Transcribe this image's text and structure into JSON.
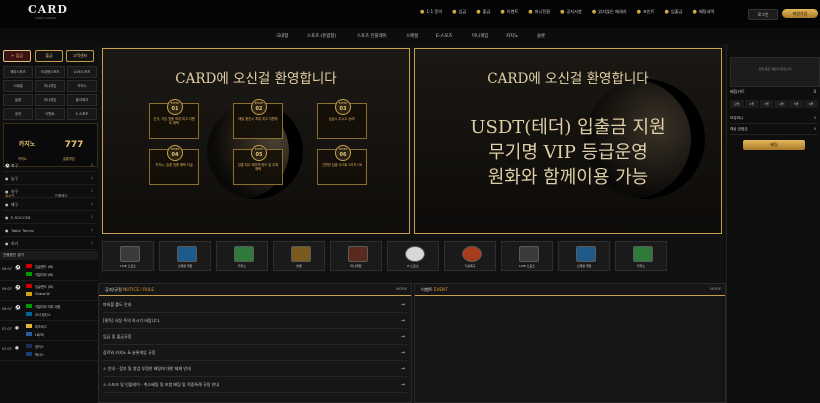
{
  "brand": {
    "logo": "CARD",
    "logo_sub": "CARD CASINO"
  },
  "topnav": [
    {
      "icon": "●",
      "label": "1:1 문의"
    },
    {
      "icon": "●",
      "label": "입금"
    },
    {
      "icon": "●",
      "label": "출금"
    },
    {
      "icon": "●",
      "label": "이벤트"
    },
    {
      "icon": "●",
      "label": "머니전환"
    },
    {
      "icon": "●",
      "label": "공지사항"
    },
    {
      "icon": "●",
      "label": "읽지않은 메세지"
    },
    {
      "icon": "●",
      "label": "포인트"
    },
    {
      "icon": "●",
      "label": "입출금"
    },
    {
      "icon": "●",
      "label": "배팅내역"
    }
  ],
  "points_label": "로그인",
  "deposit_label": "회원가입",
  "menu": [
    "국내형",
    "스포츠 (유럽형)",
    "스포츠 인플레이",
    "스페셜",
    "E-스포츠",
    "미니게임",
    "카지노",
    "슬롯"
  ],
  "left": {
    "buttons": [
      "+ 입금",
      "출금",
      "고객센터"
    ],
    "grid": [
      "해외스포츠",
      "국내형스포츠",
      "LIVE스포츠",
      "스페셜",
      "미니게임",
      "카지노",
      "슬롯",
      "미니게임",
      "출석체크",
      "공지",
      "이벤트",
      "E-스포츠"
    ],
    "promo_left": "카지노",
    "promo_right": "777",
    "promo_label_left": "카지노",
    "promo_label_right": "슬롯게임",
    "tabs": [
      "실시간",
      "인플레이"
    ],
    "sports": [
      {
        "icon": "⚽",
        "name": "축구",
        "count": "4"
      },
      {
        "icon": "●",
        "name": "농구",
        "count": "2"
      },
      {
        "icon": "●",
        "name": "야구",
        "count": "1"
      },
      {
        "icon": "●",
        "name": "배구",
        "count": "1"
      },
      {
        "icon": "●",
        "name": "E-SOCCER",
        "count": "1"
      },
      {
        "icon": "●",
        "name": "Table Tennis",
        "count": "1"
      },
      {
        "icon": "●",
        "name": "하키",
        "count": "1"
      }
    ],
    "live_head": "진행중인 경기",
    "matches": [
      {
        "time": "09:07",
        "home": "잉글랜드 (W)",
        "away": "이탈리아 (W)"
      },
      {
        "time": "09:07",
        "home": "잉글랜드 (W)",
        "away": "Ghana W"
      },
      {
        "time": "09:07",
        "home": "이탈리아 여자 대표",
        "away": "오사 팀다스"
      },
      {
        "time": "07:07",
        "home": "피츠버그",
        "away": "LB(모)"
      },
      {
        "time": "07:07",
        "home": "양키스",
        "away": "텍사스"
      }
    ]
  },
  "banner1": {
    "title": "CARD에 오신걸 환영합니다",
    "events": [
      {
        "no": "01",
        "text": "신규, 가입 첫충 최대 최고 이벤트 혜택"
      },
      {
        "no": "02",
        "text": "매일 충전시 최대 최고 지원액"
      },
      {
        "no": "03",
        "text": "입금시 무시고 승리!"
      },
      {
        "no": "04",
        "text": "카지노, 슬롯 첫충 혜택 지급"
      },
      {
        "no": "05",
        "text": "입출 최고 페이백 한도 및 무제 혜택"
      },
      {
        "no": "06",
        "text": "간편한 입출 사이트 5가지 OK"
      }
    ]
  },
  "banner2": {
    "title": "CARD에 오신걸 환영합니다",
    "line1": "USDT(테더) 입출금 지원",
    "line2": "무기명 VIP 등급운영",
    "line3": "원화와 함께이용 가능"
  },
  "games": [
    "LIVE 스포츠",
    "스페셜 게임",
    "카지노",
    "슬롯",
    "미니게임",
    "E-스포츠",
    "가상축구",
    "LIVE 스포츠",
    "스페셜 게임",
    "카지노"
  ],
  "notice": {
    "title": "공지/규정",
    "title_en": "NOTICE / RULE",
    "more": "MORE",
    "items": [
      "파워볼 룰도 안내",
      "[필독] 사칭 주의 하시기 바랍니다.",
      "입금 및 출금규정",
      "장르와 카지노 & 슬롯게임 규정",
      "⚠ 안내 - 장부 및 영업 부정한 배팅에 대한 제재 안내",
      "⚠ 스포츠 및 인플레이 - 취소배팅 및 보험 배팅 및 적중특례 규정 안내"
    ]
  },
  "event_board": {
    "title": "이벤트",
    "title_en": "EVENT",
    "more": "MORE"
  },
  "right": {
    "box_text": "진행 중인 베팅이 없습니다",
    "cart_label": "베팅카트",
    "cart_count": "0",
    "tabs": [
      "단폴",
      "2폴",
      "3폴",
      "4폴",
      "5폴",
      "6폴"
    ],
    "lines": [
      {
        "label": "보유머니",
        "value": "0"
      },
      {
        "label": "예상 당첨금",
        "value": "0"
      }
    ],
    "bet_button": "베팅"
  },
  "colors": {
    "gold": "#c9a04a",
    "accent": "#e29a2d",
    "bg": "#0b0b0b"
  }
}
